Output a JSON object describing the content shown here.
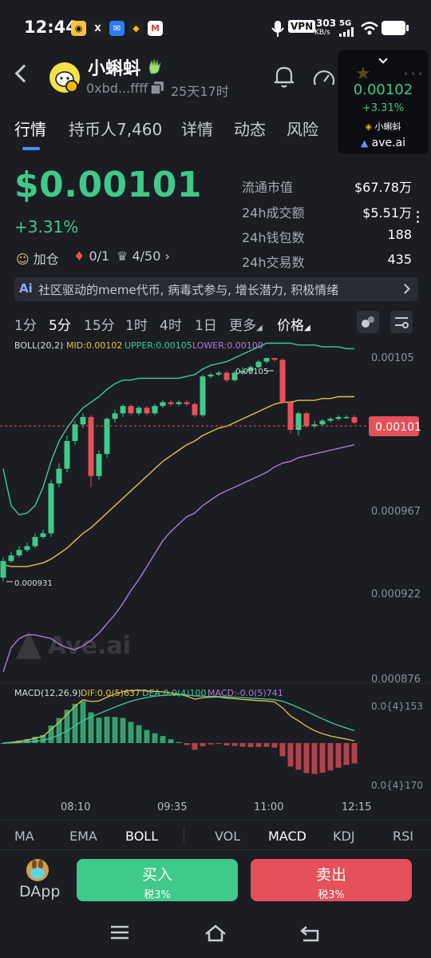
{
  "status_bar": {
    "time": "12:44",
    "net_speed": "303",
    "net_unit": "KB/s",
    "network": "5G",
    "vpn": "VPN"
  },
  "header": {
    "token_name": "小蝌蚪",
    "address": "0xbd...ffff",
    "age": "25天17时"
  },
  "widget": {
    "price": "0.00102",
    "change": "+3.31%",
    "name": "小蝌蚪",
    "brand": "ave.ai"
  },
  "tabs": [
    {
      "label": "行情"
    },
    {
      "label": "持币人7,460"
    },
    {
      "label": "详情"
    },
    {
      "label": "动态"
    },
    {
      "label": "风险"
    }
  ],
  "price": {
    "value": "$0.00101",
    "change": "+3.31%",
    "chip_add": "加仓",
    "chip_ratio": "0/1",
    "chip_rank": "4/50"
  },
  "stats": [
    {
      "label": "流通市值",
      "value": "$67.78万"
    },
    {
      "label": "24h成交额",
      "value": "$5.51万"
    },
    {
      "label": "24h钱包数",
      "value": "188"
    },
    {
      "label": "24h交易数",
      "value": "435"
    }
  ],
  "ai_banner": {
    "badge": "Ai",
    "text": "社区驱动的meme代币, 病毒式参与, 增长潜力, 积极情绪"
  },
  "intervals": [
    {
      "label": "1分"
    },
    {
      "label": "5分"
    },
    {
      "label": "15分"
    },
    {
      "label": "1时"
    },
    {
      "label": "4时"
    },
    {
      "label": "1日"
    },
    {
      "label": "更多"
    },
    {
      "label": "价格"
    }
  ],
  "boll_legend": {
    "name": "BOLL(20,2)",
    "mid": "MID:0.00102",
    "upper": "UPPER:0.00105",
    "lower": "LOWER:0.00100"
  },
  "macd_legend": {
    "name": "MACD(12,26,9)",
    "dif": "DIF:0.0(5)637",
    "dea": "DEA:0.0(4)100",
    "macd": "MACD:-0.0(5)741"
  },
  "price_axis": [
    "0.00105",
    "0.00101",
    "0.000967",
    "0.000922",
    "0.000876"
  ],
  "macd_axis": [
    "0.0{4}153",
    "0.0{4}170"
  ],
  "time_axis": [
    "08:10",
    "09:35",
    "11:00",
    "12:15"
  ],
  "current_price_tag": "0.00101",
  "high_label": "0.00105",
  "low_label": "0.000931",
  "watermark": "Ave.ai",
  "colors": {
    "up": "#3fc98a",
    "down": "#e5505a",
    "mid": "#e3c24a",
    "upper": "#3fc9a0",
    "lower": "#b07ad8",
    "accent": "#4b8ef7"
  },
  "indicators": [
    {
      "label": "MA"
    },
    {
      "label": "EMA"
    },
    {
      "label": "BOLL"
    },
    {
      "label": "VOL"
    },
    {
      "label": "MACD"
    },
    {
      "label": "KDJ"
    },
    {
      "label": "RSI"
    }
  ],
  "bottom": {
    "dapp": "DApp",
    "buy": "买入",
    "buy_tax": "税3%",
    "sell": "卖出",
    "sell_tax": "税3%"
  },
  "chart_data": {
    "type": "candlestick",
    "interval": "5分",
    "price_range": [
      0.000876,
      0.00105
    ],
    "candles": [
      {
        "o": 0.000931,
        "c": 0.00094,
        "h": 0.000942,
        "l": 0.000929
      },
      {
        "o": 0.00094,
        "c": 0.000943,
        "h": 0.000945,
        "l": 0.000939
      },
      {
        "o": 0.000943,
        "c": 0.000946,
        "h": 0.000948,
        "l": 0.000942
      },
      {
        "o": 0.000946,
        "c": 0.000948,
        "h": 0.00095,
        "l": 0.000945
      },
      {
        "o": 0.000948,
        "c": 0.000953,
        "h": 0.000955,
        "l": 0.000947
      },
      {
        "o": 0.000953,
        "c": 0.000955,
        "h": 0.000957,
        "l": 0.000952
      },
      {
        "o": 0.000955,
        "c": 0.000982,
        "h": 0.000984,
        "l": 0.000953
      },
      {
        "o": 0.000982,
        "c": 0.00099,
        "h": 0.000993,
        "l": 0.00098
      },
      {
        "o": 0.00099,
        "c": 0.001005,
        "h": 0.001008,
        "l": 0.000988
      },
      {
        "o": 0.001005,
        "c": 0.001014,
        "h": 0.001016,
        "l": 0.001003
      },
      {
        "o": 0.001014,
        "c": 0.001018,
        "h": 0.00102,
        "l": 0.001012
      },
      {
        "o": 0.001018,
        "c": 0.000986,
        "h": 0.001019,
        "l": 0.00098
      },
      {
        "o": 0.000986,
        "c": 0.000998,
        "h": 0.001,
        "l": 0.000984
      },
      {
        "o": 0.000998,
        "c": 0.001017,
        "h": 0.001018,
        "l": 0.000996
      },
      {
        "o": 0.001017,
        "c": 0.00102,
        "h": 0.001022,
        "l": 0.001015
      },
      {
        "o": 0.00102,
        "c": 0.001024,
        "h": 0.001025,
        "l": 0.001018
      },
      {
        "o": 0.001024,
        "c": 0.00102,
        "h": 0.001025,
        "l": 0.001019
      },
      {
        "o": 0.00102,
        "c": 0.001023,
        "h": 0.001024,
        "l": 0.001019
      },
      {
        "o": 0.001023,
        "c": 0.00102,
        "h": 0.001024,
        "l": 0.001019
      },
      {
        "o": 0.00102,
        "c": 0.001024,
        "h": 0.001025,
        "l": 0.001019
      },
      {
        "o": 0.001024,
        "c": 0.001026,
        "h": 0.001027,
        "l": 0.001023
      },
      {
        "o": 0.001026,
        "c": 0.001025,
        "h": 0.001027,
        "l": 0.001024
      },
      {
        "o": 0.001025,
        "c": 0.001026,
        "h": 0.001027,
        "l": 0.001024
      },
      {
        "o": 0.001026,
        "c": 0.001025,
        "h": 0.001027,
        "l": 0.001024
      },
      {
        "o": 0.001025,
        "c": 0.001019,
        "h": 0.001026,
        "l": 0.001018
      },
      {
        "o": 0.001019,
        "c": 0.00104,
        "h": 0.001041,
        "l": 0.001018
      },
      {
        "o": 0.00104,
        "c": 0.001041,
        "h": 0.001042,
        "l": 0.001039
      },
      {
        "o": 0.001041,
        "c": 0.001042,
        "h": 0.001043,
        "l": 0.00104
      },
      {
        "o": 0.001042,
        "c": 0.001038,
        "h": 0.001043,
        "l": 0.001037
      },
      {
        "o": 0.001038,
        "c": 0.001042,
        "h": 0.001043,
        "l": 0.001037
      },
      {
        "o": 0.001042,
        "c": 0.001043,
        "h": 0.001045,
        "l": 0.001041
      },
      {
        "o": 0.001043,
        "c": 0.001045,
        "h": 0.001046,
        "l": 0.001042
      },
      {
        "o": 0.001045,
        "c": 0.001048,
        "h": 0.001049,
        "l": 0.001044
      },
      {
        "o": 0.001048,
        "c": 0.00105,
        "h": 0.00105,
        "l": 0.001047
      },
      {
        "o": 0.00105,
        "c": 0.001049,
        "h": 0.00105,
        "l": 0.001048
      },
      {
        "o": 0.001049,
        "c": 0.001026,
        "h": 0.00105,
        "l": 0.001025
      },
      {
        "o": 0.001026,
        "c": 0.001011,
        "h": 0.001027,
        "l": 0.001009
      },
      {
        "o": 0.001011,
        "c": 0.00102,
        "h": 0.001021,
        "l": 0.001008
      },
      {
        "o": 0.00102,
        "c": 0.001013,
        "h": 0.001021,
        "l": 0.001012
      },
      {
        "o": 0.001013,
        "c": 0.001014,
        "h": 0.001016,
        "l": 0.001012
      },
      {
        "o": 0.001014,
        "c": 0.001016,
        "h": 0.001017,
        "l": 0.001013
      },
      {
        "o": 0.001016,
        "c": 0.001017,
        "h": 0.001018,
        "l": 0.001015
      },
      {
        "o": 0.001017,
        "c": 0.001018,
        "h": 0.001019,
        "l": 0.001016
      },
      {
        "o": 0.001018,
        "c": 0.001018,
        "h": 0.001019,
        "l": 0.001017
      },
      {
        "o": 0.001018,
        "c": 0.001015,
        "h": 0.001019,
        "l": 0.001014
      }
    ],
    "boll_upper": [
      0.00099,
      0.00097,
      0.000965,
      0.000966,
      0.00097,
      0.00098,
      0.000994,
      0.001005,
      0.001012,
      0.001018,
      0.001023,
      0.001026,
      0.001029,
      0.001033,
      0.001036,
      0.001038,
      0.001038,
      0.001039,
      0.001039,
      0.001039,
      0.001039,
      0.001039,
      0.001039,
      0.00104,
      0.001041,
      0.001044,
      0.001046,
      0.001047,
      0.001048,
      0.00105,
      0.001052,
      0.001054,
      0.001056,
      0.001058,
      0.001058,
      0.001058,
      0.001058,
      0.001057,
      0.001057,
      0.001057,
      0.001056,
      0.001056,
      0.001056,
      0.001055,
      0.001055
    ],
    "boll_mid": [
      0.000938,
      0.000937,
      0.000937,
      0.000937,
      0.000938,
      0.000939,
      0.000941,
      0.000944,
      0.000947,
      0.000951,
      0.000955,
      0.000958,
      0.000962,
      0.000966,
      0.00097,
      0.000974,
      0.000978,
      0.000982,
      0.000986,
      0.00099,
      0.000994,
      0.000997,
      0.001,
      0.001003,
      0.001005,
      0.001008,
      0.00101,
      0.001012,
      0.001013,
      0.001015,
      0.001017,
      0.001019,
      0.001021,
      0.001023,
      0.001025,
      0.001026,
      0.001026,
      0.001027,
      0.001027,
      0.001027,
      0.001028,
      0.001028,
      0.001029,
      0.001029,
      0.001029
    ],
    "boll_lower": [
      0.00088,
      0.000893,
      0.000898,
      0.0009,
      0.0009,
      0.000899,
      0.000898,
      0.000895,
      0.000893,
      0.000892,
      0.000894,
      0.000897,
      0.000901,
      0.000906,
      0.000911,
      0.000917,
      0.000924,
      0.00093,
      0.000937,
      0.000944,
      0.000951,
      0.000956,
      0.00096,
      0.000964,
      0.000966,
      0.00097,
      0.000973,
      0.000976,
      0.000978,
      0.00098,
      0.000982,
      0.000984,
      0.000986,
      0.000988,
      0.000991,
      0.000993,
      0.000994,
      0.000996,
      0.000997,
      0.000998,
      0.000999,
      0.001,
      0.001001,
      0.001002,
      0.001003
    ]
  }
}
